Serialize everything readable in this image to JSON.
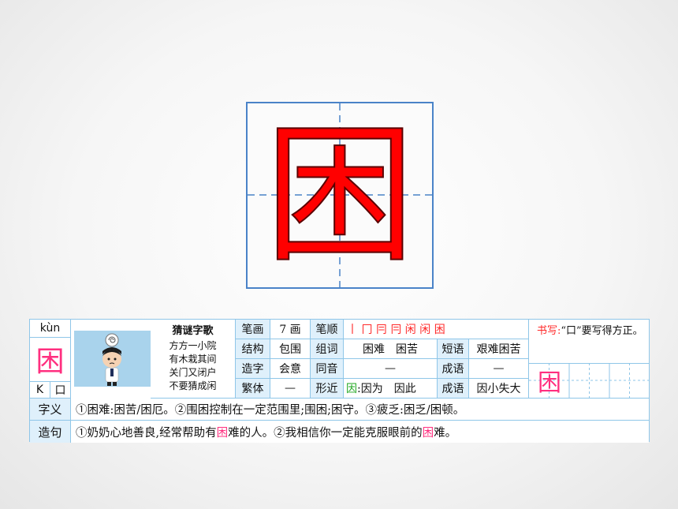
{
  "main_character": "困",
  "card": {
    "pinyin": "kùn",
    "character": "困",
    "index_letter": "K",
    "radical": "口",
    "riddle": {
      "title": "猜谜字歌",
      "lines": [
        "方方一小院",
        "有木栽其间",
        "关门又闭户",
        "不要猜成闲"
      ]
    },
    "strokes_label": "笔画",
    "strokes_value": "7 画",
    "order_label": "笔顺",
    "order_value": "丨 冂 冃 冃 闲 闲 困",
    "structure_label": "结构",
    "structure_value": "包围",
    "words_label": "组词",
    "words_value": "困难　困苦",
    "phrase_label": "短语",
    "phrase_value": "艰难困苦",
    "formation_label": "造字",
    "formation_value": "会意",
    "homophone_label": "同音",
    "homophone_value": "—",
    "idiom_label": "成语",
    "idiom_value": "—",
    "traditional_label": "繁体",
    "traditional_value": "—",
    "similar_label": "形近",
    "similar_char": "因",
    "similar_value": ":因为　因此",
    "idiom2_label": "成语",
    "idiom2_value": "因小失大",
    "writing_tip_label": "书写:",
    "writing_tip_text": "“口”要写得方正。",
    "practice_char": "困",
    "meaning_label": "字义",
    "meaning_text": "①困难:困苦/困厄。②围困控制在一定范围里;围困;困守。③疲乏:困乏/困顿。",
    "sentence_label": "造句",
    "sentence_part1": "①奶奶心地善良,经常帮助有",
    "sentence_hl1": "困",
    "sentence_part2": "难的人。②我相信你一定能克服眼前的",
    "sentence_hl2": "困",
    "sentence_part3": "难。"
  },
  "colors": {
    "char_red": "#ff0000",
    "grid_blue": "#4a83c8",
    "table_border": "#8fc6e8",
    "header_fill": "#dff0fb",
    "accent_pink": "#ff2f7f",
    "similar_green": "#1ea61e"
  }
}
